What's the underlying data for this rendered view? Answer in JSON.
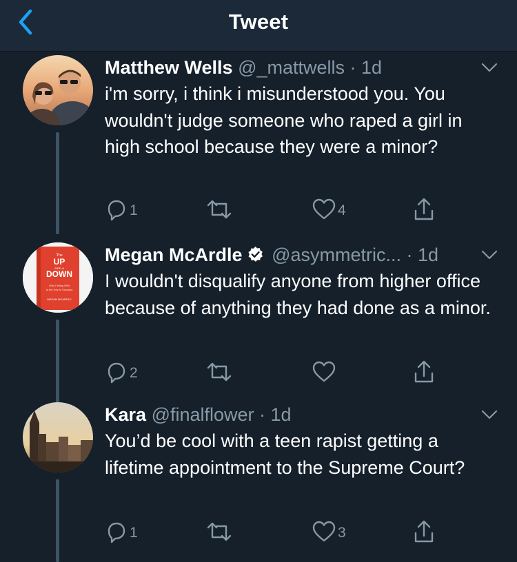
{
  "navbar": {
    "title": "Tweet"
  },
  "colors": {
    "background": "#15202b",
    "navbar": "#1c2938",
    "accent": "#1da1f2",
    "secondary_text": "#8899a6",
    "thread_line": "#3d5466"
  },
  "tweets": [
    {
      "name": "Matthew Wells",
      "handle": "@_mattwells",
      "time": "· 1d",
      "verified": false,
      "avatar": "couple-sunset-photo",
      "text": "i'm sorry, i think i misunderstood you. You wouldn't judge someone who raped a girl in high school because they were a minor?",
      "replies": "1",
      "retweets": "",
      "likes": "4"
    },
    {
      "name": "Megan McArdle",
      "handle": "@asymmetric...",
      "time": "· 1d",
      "verified": true,
      "avatar": "book-cover-up-down",
      "avatar_text": {
        "the": "The",
        "up": "UP",
        "side_of": "SIDE of",
        "down": "DOWN",
        "subtitle1": "Why Failing Well",
        "subtitle2": "Is the Key to Success",
        "author": "MEGAN MCARDLE"
      },
      "text": "I wouldn't disqualify anyone from higher office because of anything they had done as a minor.",
      "replies": "2",
      "retweets": "",
      "likes": ""
    },
    {
      "name": "Kara",
      "handle": "@finalflower",
      "time": "· 1d",
      "verified": false,
      "avatar": "city-skyline-photo",
      "text": "You’d be cool with a teen rapist getting a lifetime appointment to the Supreme Court?",
      "replies": "1",
      "retweets": "",
      "likes": "3"
    }
  ]
}
